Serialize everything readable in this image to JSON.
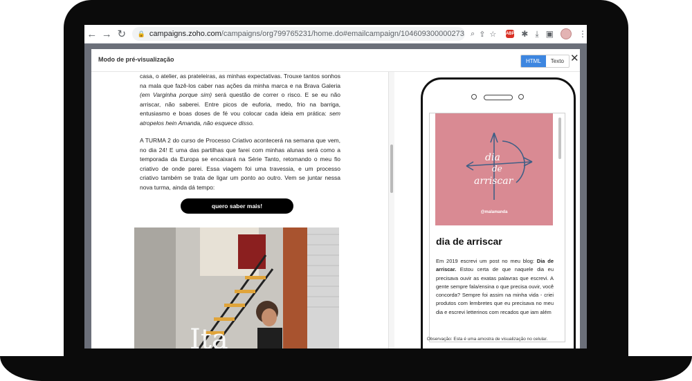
{
  "browser": {
    "url_host": "campaigns.zoho.com",
    "url_path": "/campaigns/org799765231/home.do#emailcampaign/1046093000002731002/cmpde...",
    "icons": [
      "back-icon",
      "forward-icon",
      "reload-icon",
      "lock-icon",
      "zoom-icon",
      "share-icon",
      "star-icon",
      "extensions-icon",
      "download-icon",
      "sidepanel-icon",
      "profile-avatar",
      "menu-icon"
    ],
    "abp_label": "ABP"
  },
  "modal": {
    "title": "Modo de pré-visualização",
    "toggle": {
      "html": "HTML",
      "text": "Texto",
      "selected": "HTML"
    },
    "close_label": "✕"
  },
  "email": {
    "para1_a": "casa, o atelier, as prateleiras, as minhas expectativas. Trouxe tantos sonhos na mala que fazê-los caber nas ações da minha marca e na Brava Galeria ",
    "para1_b": "(em Varginha porque sim)",
    "para1_c": " será questão de correr o risco. E se eu não arriscar, não saberei. Entre picos de euforia, medo, frio na barriga, entusiasmo e boas doses de fé vou colocar cada ideia em prática: ",
    "para1_d": "sem atropelos hein Amanda, não esquece disso.",
    "para2": "A TURMA 2 do curso de Processo Criativo acontecerá na semana que vem, no dia 24! E uma das partilhas que farei com minhas alunas será como a temporada da Europa se encaixará na Série Tanto, retomando o meu fio criativo de onde parei. Essa viagem foi uma travessia, e um processo criativo também se trata de ligar um ponto ao outro. Vem se juntar nessa nova turma, ainda dá tempo:",
    "cta": "quero saber mais!"
  },
  "phone_preview": {
    "image_text_1": "dia",
    "image_text_2": "de",
    "image_text_3": "arriscar",
    "handle": "@malamanda",
    "title": "dia de arriscar",
    "body_a": "Em 2019 escrevi um post no meu blog: ",
    "body_b": "Dia de arriscar.",
    "body_c": " Estou certa de que naquele dia eu precisava ouvir as exatas palavras que escrevi. A gente sempre fala/ensina o que precisa ouvir, você concorda? Sempre foi assim na minha vida - criei produtos com lembretes que eu precisava no meu dia e escrevi letterinos com recados que iam além",
    "note": "Observação: Esta é uma amostra de visualização no celular."
  },
  "colors": {
    "accent": "#3d86e0",
    "pink": "#d98a93",
    "compass": "#3f5f86"
  }
}
